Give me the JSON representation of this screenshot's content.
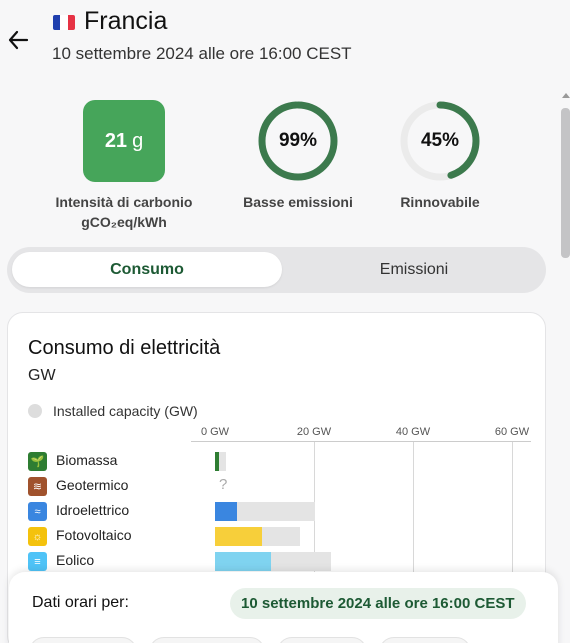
{
  "header": {
    "country": "Francia",
    "datetime": "10 settembre 2024 alle ore 16:00 CEST",
    "flag_colors": [
      "#1f3fae",
      "#ffffff",
      "#e63244"
    ]
  },
  "kpis": {
    "carbon": {
      "value": "21",
      "unit": "g",
      "label_line1": "Intensità di carbonio",
      "label_line2": "gCO₂eq/kWh",
      "color": "#46a55a"
    },
    "low_emissions": {
      "value": 0.99,
      "text": "99%",
      "label": "Basse emissioni",
      "color": "#3c7a4d"
    },
    "renewable": {
      "value": 0.45,
      "text": "45%",
      "label": "Rinnovabile",
      "color": "#3c7a4d"
    }
  },
  "toggle": {
    "active": "Consumo",
    "inactive": "Emissioni"
  },
  "card": {
    "title": "Consumo di elettricità",
    "unit": "GW",
    "legend": "Installed capacity (GW)"
  },
  "chart_data": {
    "type": "bar",
    "orientation": "horizontal",
    "x_ticks": [
      "0 GW",
      "20 GW",
      "40 GW",
      "60 GW"
    ],
    "xlim": [
      0,
      60
    ],
    "unit": "GW",
    "series": [
      {
        "name": "Installed capacity (GW)",
        "values": [
          2.2,
          null,
          20.2,
          17.2,
          23.5
        ]
      },
      {
        "name": "Consumo",
        "values": [
          0.9,
          null,
          4.5,
          9.5,
          11.4
        ]
      }
    ],
    "categories": [
      "Biomassa",
      "Geotermico",
      "Idroelettrico",
      "Fotovoltaico",
      "Eolico"
    ],
    "unknown_marker": "?"
  },
  "sources": [
    {
      "name": "Biomassa",
      "icon": "leaf-icon",
      "icon_glyph": "🌱",
      "icon_color": "#2e7d32",
      "bar_color": "#2e7d32"
    },
    {
      "name": "Geotermico",
      "icon": "geothermal-icon",
      "icon_glyph": "≋",
      "icon_color": "#a0522d",
      "bar_color": "#a0522d"
    },
    {
      "name": "Idroelettrico",
      "icon": "water-icon",
      "icon_glyph": "≈",
      "icon_color": "#3a86e0",
      "bar_color": "#3a86e0"
    },
    {
      "name": "Fotovoltaico",
      "icon": "sun-icon",
      "icon_glyph": "☼",
      "icon_color": "#f4c20d",
      "bar_color": "#f7cf3a"
    },
    {
      "name": "Eolico",
      "icon": "wind-icon",
      "icon_glyph": "≡",
      "icon_color": "#4fc3f7",
      "bar_color": "#7fd3f0"
    }
  ],
  "bottom_panel": {
    "label": "Dati orari per:",
    "chip": "10 settembre 2024 alle ore 16:00 CEST"
  }
}
